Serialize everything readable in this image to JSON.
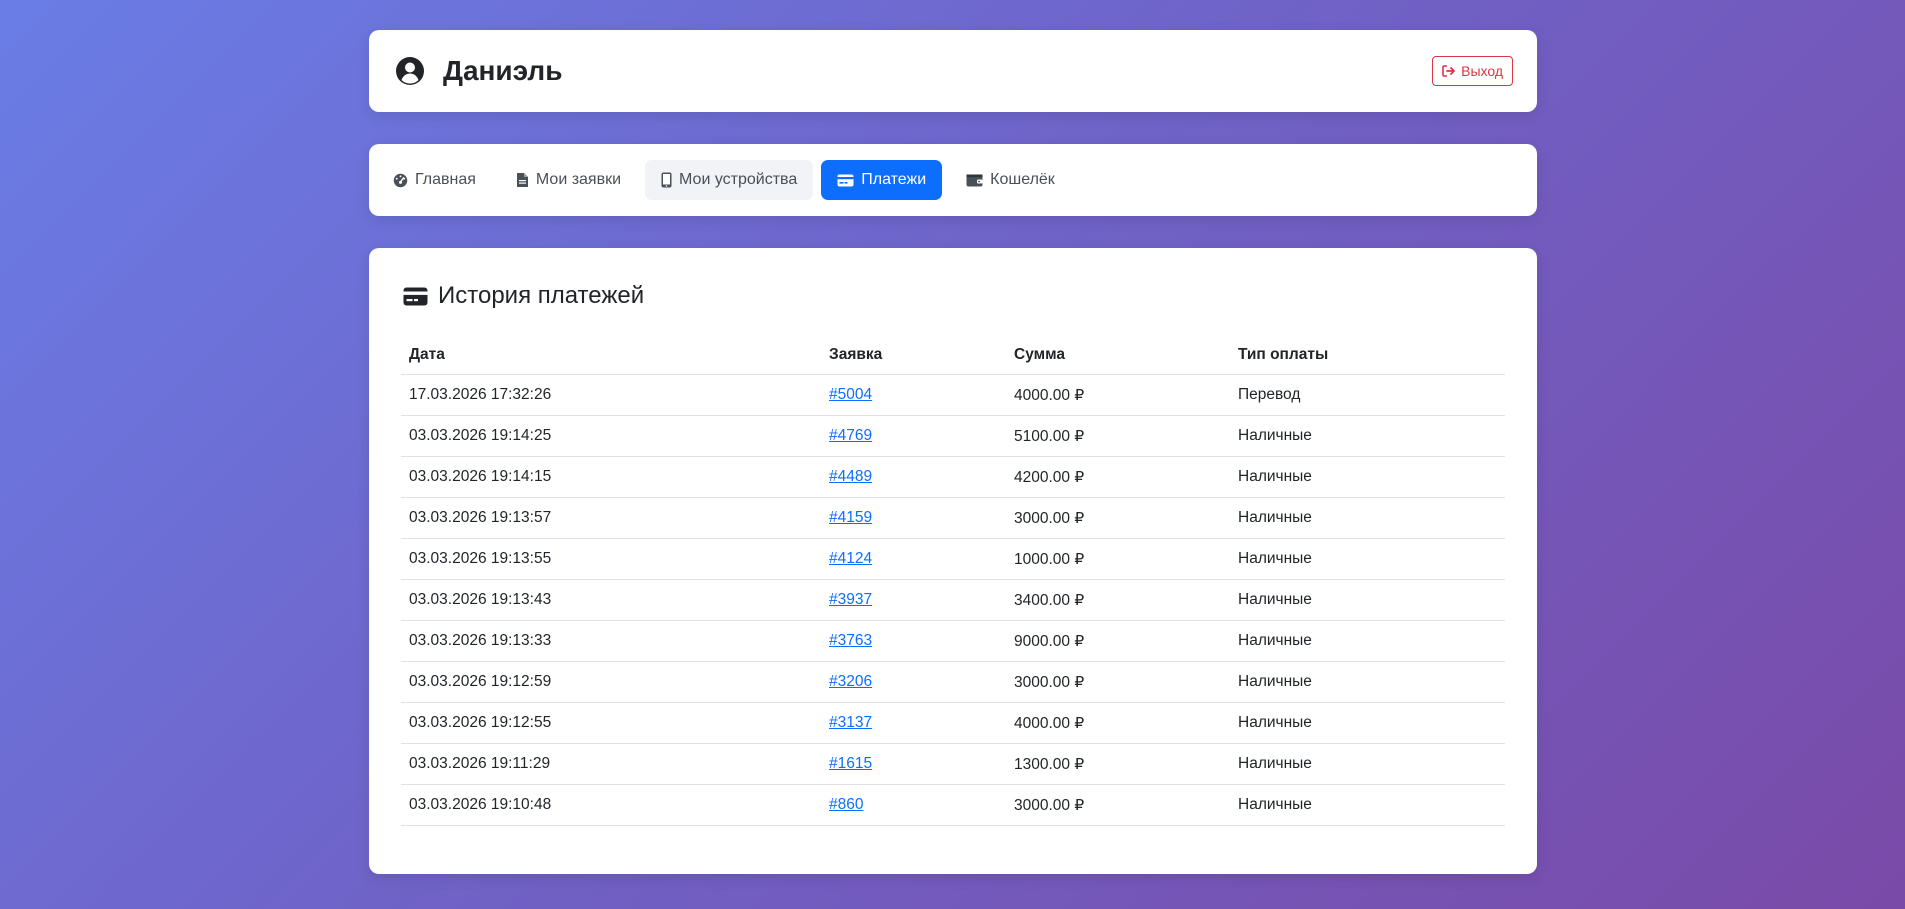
{
  "user": {
    "name": "Даниэль",
    "icon": "user-circle-icon"
  },
  "header": {
    "logout_label": "Выход",
    "logout_icon": "sign-out-icon"
  },
  "nav": {
    "items": [
      {
        "label": "Главная",
        "icon": "dashboard-icon",
        "state": "normal"
      },
      {
        "label": "Мои заявки",
        "icon": "document-icon",
        "state": "normal"
      },
      {
        "label": "Мои устройства",
        "icon": "mobile-icon",
        "state": "hover"
      },
      {
        "label": "Платежи",
        "icon": "credit-card-icon",
        "state": "active"
      },
      {
        "label": "Кошелёк",
        "icon": "wallet-icon",
        "state": "normal"
      }
    ]
  },
  "payments": {
    "title": "История платежей",
    "columns": [
      "Дата",
      "Заявка",
      "Сумма",
      "Тип оплаты"
    ],
    "rows": [
      {
        "date": "17.03.2026 17:32:26",
        "request": "#5004",
        "amount": "4000.00 ₽",
        "type": "Перевод"
      },
      {
        "date": "03.03.2026 19:14:25",
        "request": "#4769",
        "amount": "5100.00 ₽",
        "type": "Наличные"
      },
      {
        "date": "03.03.2026 19:14:15",
        "request": "#4489",
        "amount": "4200.00 ₽",
        "type": "Наличные"
      },
      {
        "date": "03.03.2026 19:13:57",
        "request": "#4159",
        "amount": "3000.00 ₽",
        "type": "Наличные"
      },
      {
        "date": "03.03.2026 19:13:55",
        "request": "#4124",
        "amount": "1000.00 ₽",
        "type": "Наличные"
      },
      {
        "date": "03.03.2026 19:13:43",
        "request": "#3937",
        "amount": "3400.00 ₽",
        "type": "Наличные"
      },
      {
        "date": "03.03.2026 19:13:33",
        "request": "#3763",
        "amount": "9000.00 ₽",
        "type": "Наличные"
      },
      {
        "date": "03.03.2026 19:12:59",
        "request": "#3206",
        "amount": "3000.00 ₽",
        "type": "Наличные"
      },
      {
        "date": "03.03.2026 19:12:55",
        "request": "#3137",
        "amount": "4000.00 ₽",
        "type": "Наличные"
      },
      {
        "date": "03.03.2026 19:11:29",
        "request": "#1615",
        "amount": "1300.00 ₽",
        "type": "Наличные"
      },
      {
        "date": "03.03.2026 19:10:48",
        "request": "#860",
        "amount": "3000.00 ₽",
        "type": "Наличные"
      }
    ]
  },
  "colors": {
    "accent": "#0d6efd",
    "danger": "#dc3545",
    "background_start": "#6a7de6",
    "background_end": "#7a4aa8"
  }
}
